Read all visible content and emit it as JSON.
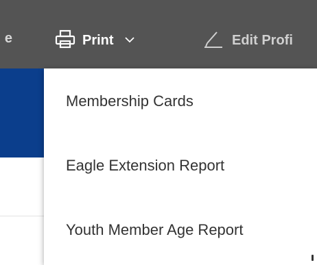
{
  "topbar": {
    "truncated_left_text": "e",
    "print": {
      "label": "Print",
      "icon": "printer-icon",
      "chevron": "chevron-down-icon"
    },
    "edit": {
      "label": "Edit Profi",
      "icon": "pencil-icon"
    }
  },
  "print_menu": {
    "items": [
      {
        "label": "Membership Cards"
      },
      {
        "label": "Eagle Extension Report"
      },
      {
        "label": "Youth Member Age Report"
      }
    ]
  },
  "colors": {
    "topbar_bg": "#545454",
    "band_blue": "#0b3e8c",
    "menu_bg": "#ffffff",
    "menu_text": "#333333"
  }
}
